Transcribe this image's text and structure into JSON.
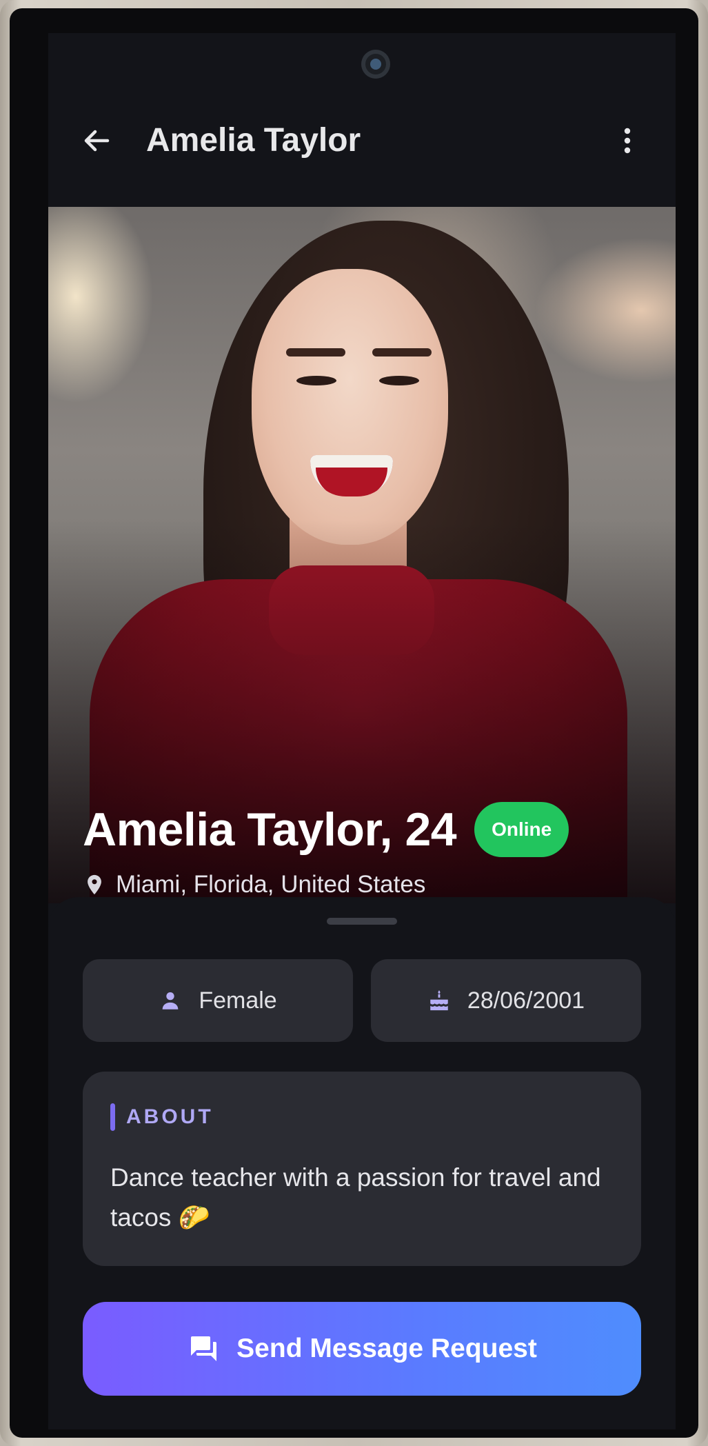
{
  "app": {
    "title": "Amelia Taylor"
  },
  "profile": {
    "name_age": "Amelia Taylor, 24",
    "status": "Online",
    "location": "Miami, Florida, United States",
    "gender": "Female",
    "birthdate": "28/06/2001"
  },
  "about": {
    "label": "ABOUT",
    "text": "Dance teacher with a passion for travel and tacos 🌮"
  },
  "cta": {
    "label": "Send Message Request"
  },
  "icons": {
    "back": "arrow-left-icon",
    "menu": "more-vertical-icon",
    "location": "location-pin-icon",
    "gender": "person-icon",
    "birthday": "cake-icon",
    "message": "chat-bubbles-icon"
  },
  "colors": {
    "online": "#22c55e",
    "accent": "#7c6cf0",
    "cta_start": "#7a5cff",
    "cta_end": "#4f8dfd"
  }
}
